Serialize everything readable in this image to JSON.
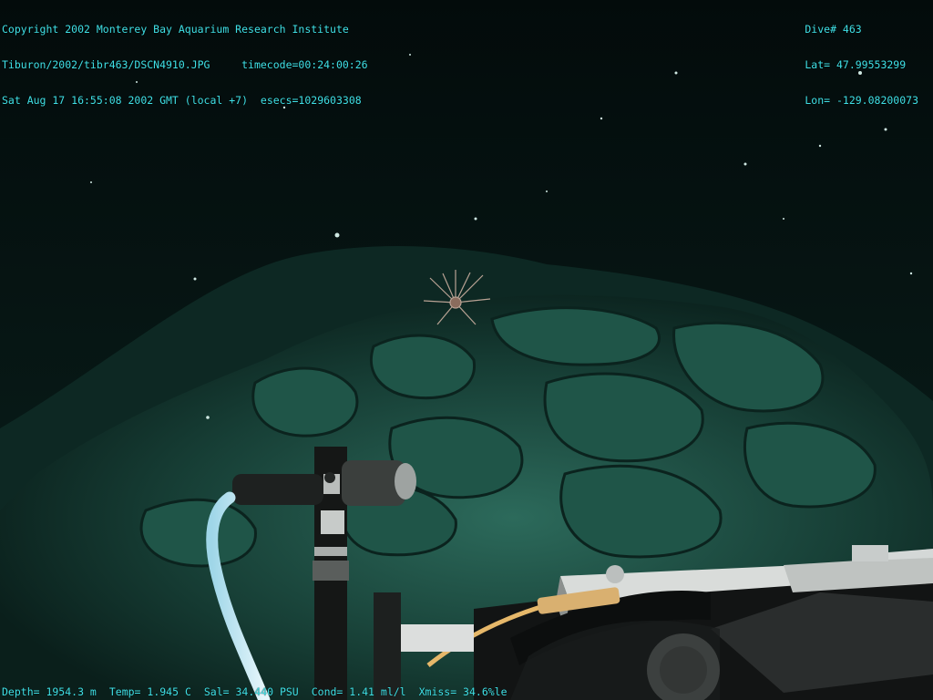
{
  "header_left": {
    "line1": "Copyright 2002 Monterey Bay Aquarium Research Institute",
    "line2_file": "Tiburon/2002/tibr463/DSCN4910.JPG",
    "line2_timecode": "timecode=00:24:00:26",
    "line3_date": "Sat Aug 17 16:55:08 2002 GMT (local +7)",
    "line3_esecs": "esecs=1029603308"
  },
  "header_right": {
    "dive": "Dive# 463",
    "lat": "Lat= 47.99553299",
    "lon": "Lon= -129.08200073"
  },
  "footer": {
    "depth": "Depth= 1954.3 m",
    "temp": "Temp= 1.945 C",
    "sal": "Sal= 34.440 PSU",
    "cond": "Cond= 1.41 ml/l",
    "xmiss": "Xmiss= 34.6%le"
  },
  "colors": {
    "overlay_text": "#3fe0e6",
    "water": "#050f0e",
    "rock": "#1b4a40"
  }
}
